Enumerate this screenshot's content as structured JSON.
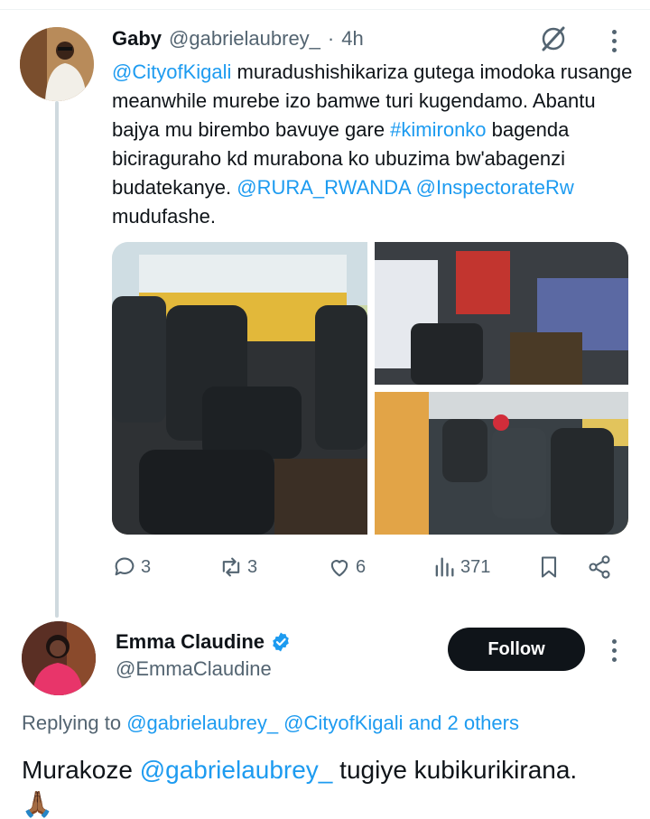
{
  "tweet1": {
    "name": "Gaby",
    "handle": "@gabrielaubrey_",
    "separator": "·",
    "time": "4h",
    "text": {
      "mention1": "@CityofKigali",
      "part1": " muradushishikariza gutega imodoka rusange meanwhile murebe izo bamwe turi kugendamo. Abantu bajya mu birembo bavuye  gare ",
      "hashtag": "#kimironko",
      "part2": " bagenda biciraguraho kd murabona ko ubuzima bw'abagenzi budatekanye. ",
      "mention2": "@RURA_RWANDA",
      "space": " ",
      "mention3": "@InspectorateRw",
      "part3": " mudufashe."
    },
    "actions": {
      "replies": "3",
      "reposts": "3",
      "likes": "6",
      "views": "371"
    },
    "icons": {
      "grok": "grok-icon",
      "more": "more-icon",
      "reply": "reply-icon",
      "repost": "repost-icon",
      "like": "heart-icon",
      "views": "views-icon",
      "bookmark": "bookmark-icon",
      "share": "share-icon"
    }
  },
  "tweet2": {
    "name": "Emma Claudine",
    "handle": "@EmmaClaudine",
    "follow_label": "Follow",
    "replying_prefix": "Replying to ",
    "replying_mentions": "@gabrielaubrey_ @CityofKigali and 2 others",
    "text_prefix": "Murakoze ",
    "text_mention": "@gabrielaubrey_",
    "text_suffix": " tugiye kubikurikirana.",
    "emoji": "🙏🏾"
  },
  "colors": {
    "link": "#1d9bf0",
    "text": "#0f1419",
    "secondary": "#536471",
    "verified": "#1d9bf0",
    "follow_bg": "#0f1419"
  }
}
